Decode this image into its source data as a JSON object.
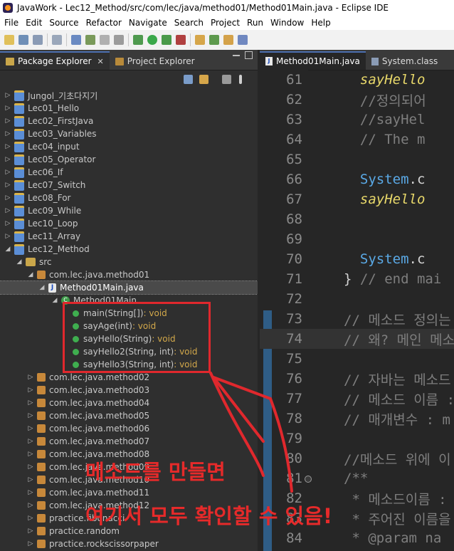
{
  "window": {
    "title": "JavaWork - Lec12_Method/src/com/lec/java/method01/Method01Main.java - Eclipse IDE"
  },
  "menu": [
    "File",
    "Edit",
    "Source",
    "Refactor",
    "Navigate",
    "Search",
    "Project",
    "Run",
    "Window",
    "Help"
  ],
  "left_tabs": {
    "active": "Package Explorer",
    "other": "Project Explorer",
    "close": "✕"
  },
  "tree": [
    {
      "label": "Jungol_기초다지기",
      "kind": "proj",
      "indent": 0,
      "twisty": "▷"
    },
    {
      "label": "Lec01_Hello",
      "kind": "proj",
      "indent": 0,
      "twisty": "▷"
    },
    {
      "label": "Lec02_FirstJava",
      "kind": "proj",
      "indent": 0,
      "twisty": "▷"
    },
    {
      "label": "Lec03_Variables",
      "kind": "proj",
      "indent": 0,
      "twisty": "▷"
    },
    {
      "label": "Lec04_input",
      "kind": "proj",
      "indent": 0,
      "twisty": "▷"
    },
    {
      "label": "Lec05_Operator",
      "kind": "proj",
      "indent": 0,
      "twisty": "▷"
    },
    {
      "label": "Lec06_If",
      "kind": "proj",
      "indent": 0,
      "twisty": "▷"
    },
    {
      "label": "Lec07_Switch",
      "kind": "proj",
      "indent": 0,
      "twisty": "▷"
    },
    {
      "label": "Lec08_For",
      "kind": "proj",
      "indent": 0,
      "twisty": "▷"
    },
    {
      "label": "Lec09_While",
      "kind": "proj",
      "indent": 0,
      "twisty": "▷"
    },
    {
      "label": "Lec10_Loop",
      "kind": "proj",
      "indent": 0,
      "twisty": "▷"
    },
    {
      "label": "Lec11_Array",
      "kind": "proj",
      "indent": 0,
      "twisty": "▷"
    },
    {
      "label": "Lec12_Method",
      "kind": "proj",
      "indent": 0,
      "twisty": "◢"
    },
    {
      "label": "src",
      "kind": "src",
      "indent": 1,
      "twisty": "◢"
    },
    {
      "label": "com.lec.java.method01",
      "kind": "pkg",
      "indent": 2,
      "twisty": "◢"
    },
    {
      "label": "Method01Main.java",
      "kind": "java",
      "indent": 3,
      "twisty": "◢",
      "selected": true
    },
    {
      "label": "Method01Main",
      "kind": "cls",
      "indent": 4,
      "twisty": "◢"
    },
    {
      "label": "main(String[])",
      "ret": " : void",
      "kind": "meth",
      "indent": 5,
      "twisty": ""
    },
    {
      "label": "sayAge(int)",
      "ret": " : void",
      "kind": "meth",
      "indent": 5,
      "twisty": ""
    },
    {
      "label": "sayHello(String)",
      "ret": " : void",
      "kind": "meth",
      "indent": 5,
      "twisty": ""
    },
    {
      "label": "sayHello2(String, int)",
      "ret": " : void",
      "kind": "meth",
      "indent": 5,
      "twisty": ""
    },
    {
      "label": "sayHello3(String, int)",
      "ret": " : void",
      "kind": "meth",
      "indent": 5,
      "twisty": ""
    },
    {
      "label": "com.lec.java.method02",
      "kind": "pkg",
      "indent": 2,
      "twisty": "▷"
    },
    {
      "label": "com.lec.java.method03",
      "kind": "pkg",
      "indent": 2,
      "twisty": "▷"
    },
    {
      "label": "com.lec.java.method04",
      "kind": "pkg",
      "indent": 2,
      "twisty": "▷"
    },
    {
      "label": "com.lec.java.method05",
      "kind": "pkg",
      "indent": 2,
      "twisty": "▷"
    },
    {
      "label": "com.lec.java.method06",
      "kind": "pkg",
      "indent": 2,
      "twisty": "▷"
    },
    {
      "label": "com.lec.java.method07",
      "kind": "pkg",
      "indent": 2,
      "twisty": "▷"
    },
    {
      "label": "com.lec.java.method08",
      "kind": "pkg",
      "indent": 2,
      "twisty": "▷"
    },
    {
      "label": "com.lec.java.method09",
      "kind": "pkg",
      "indent": 2,
      "twisty": "▷"
    },
    {
      "label": "com.lec.java.method10",
      "kind": "pkg",
      "indent": 2,
      "twisty": "▷"
    },
    {
      "label": "com.lec.java.method11",
      "kind": "pkg",
      "indent": 2,
      "twisty": "▷"
    },
    {
      "label": "com.lec.java.method12",
      "kind": "pkg",
      "indent": 2,
      "twisty": "▷"
    },
    {
      "label": "practice.fibonacci",
      "kind": "pkg",
      "indent": 2,
      "twisty": "▷"
    },
    {
      "label": "practice.random",
      "kind": "pkg",
      "indent": 2,
      "twisty": "▷"
    },
    {
      "label": "practice.rockscissorpaper",
      "kind": "pkg",
      "indent": 2,
      "twisty": "▷"
    }
  ],
  "editor_tabs": [
    {
      "label": "Method01Main.java",
      "active": true
    },
    {
      "label": "System.class",
      "active": false
    }
  ],
  "code_lines": [
    {
      "num": "61",
      "text": "  sayHello",
      "style": "itl"
    },
    {
      "num": "62",
      "text": "  //정의되어",
      "style": "cmt"
    },
    {
      "num": "63",
      "text": "  //sayHel",
      "style": "cmt"
    },
    {
      "num": "64",
      "text": "  // The m",
      "style": "cmt"
    },
    {
      "num": "65",
      "text": "",
      "style": "kw"
    },
    {
      "num": "66",
      "text": "  System.c",
      "style": "sys"
    },
    {
      "num": "67",
      "text": "  sayHello",
      "style": "itl"
    },
    {
      "num": "68",
      "text": "",
      "style": "kw"
    },
    {
      "num": "69",
      "text": "",
      "style": "kw"
    },
    {
      "num": "70",
      "text": "  System.c",
      "style": "sys"
    },
    {
      "num": "71",
      "text": "} // end mai",
      "style": "mixed"
    },
    {
      "num": "72",
      "text": "",
      "style": "kw"
    },
    {
      "num": "73",
      "text": "// 메소드 정의는",
      "style": "cmt"
    },
    {
      "num": "74",
      "text": "// 왜? 메인 메소",
      "style": "cmt"
    },
    {
      "num": "75",
      "text": "",
      "style": "kw"
    },
    {
      "num": "76",
      "text": "// 자바는 메소드",
      "style": "cmt"
    },
    {
      "num": "77",
      "text": "// 메소드 이름 :",
      "style": "cmt"
    },
    {
      "num": "78",
      "text": "// 매개변수 : m",
      "style": "cmt"
    },
    {
      "num": "79",
      "text": "",
      "style": "kw"
    },
    {
      "num": "80",
      "text": "//메소드 위에 이",
      "style": "cmt"
    },
    {
      "num": "81",
      "text": "/**",
      "style": "cmt"
    },
    {
      "num": "82",
      "text": " * 메소드이름 :",
      "style": "cmt"
    },
    {
      "num": "83",
      "text": " * 주어진 이름을",
      "style": "cmt"
    },
    {
      "num": "84",
      "text": " * @param na",
      "style": "cmt"
    }
  ],
  "annotation": {
    "line1": "메소드를 만들면",
    "line2": "여기서 모두 확인할 수 있음!",
    "color": "#e0282d"
  }
}
